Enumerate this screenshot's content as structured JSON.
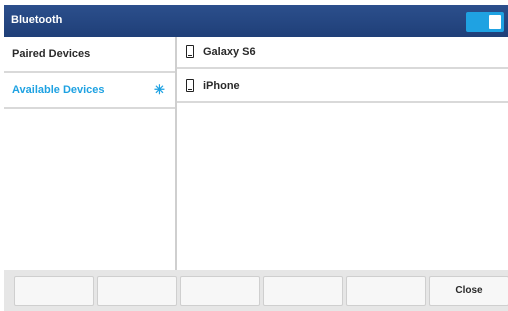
{
  "window": {
    "title": "Bluetooth"
  },
  "toggle": {
    "state": "on",
    "accent": "#1fa2e2"
  },
  "sidebar": {
    "items": [
      {
        "label": "Paired Devices",
        "active": false
      },
      {
        "label": "Available Devices",
        "active": true,
        "icon": "spinner-icon"
      }
    ]
  },
  "devices": [
    {
      "label": "Galaxy S6",
      "icon": "phone-icon"
    },
    {
      "label": "iPhone",
      "icon": "phone-icon"
    }
  ],
  "softkeys": [
    "",
    "",
    "",
    "",
    "",
    "Close"
  ]
}
